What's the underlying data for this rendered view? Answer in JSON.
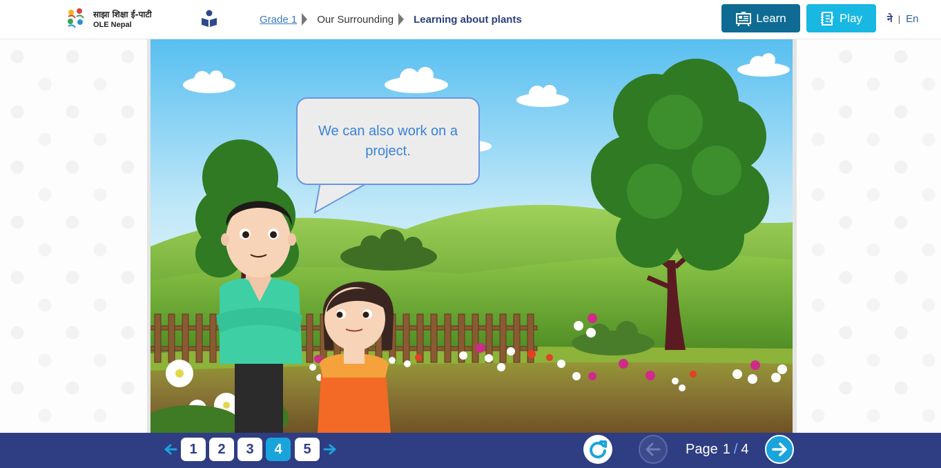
{
  "header": {
    "logo_text_np": "साझा शिक्षा ई-पाटी",
    "logo_text_en": "OLE Nepal",
    "breadcrumb": {
      "grade": "Grade 1",
      "subject": "Our Surrounding",
      "lesson": "Learning about plants"
    },
    "learn_label": "Learn",
    "play_label": "Play",
    "lang_np": "ने",
    "lang_sep": "|",
    "lang_en": "En"
  },
  "scene": {
    "speech_text": "We can also work on a project."
  },
  "footer": {
    "pages": [
      "1",
      "2",
      "3",
      "4",
      "5"
    ],
    "active_page": "4",
    "page_label": "Page",
    "current_page": "1",
    "page_sep": "/",
    "total_pages": "4"
  },
  "colors": {
    "header_learn": "#0f6b93",
    "header_play": "#18b8e2",
    "footer_bg": "#2f3d82",
    "active_page": "#1aa4dc",
    "speech_text": "#3a82d8"
  },
  "icons": {
    "logo": "ole-nepal-logo",
    "book": "book-reader-icon",
    "learn": "learn-board-icon",
    "play": "play-notebook-icon",
    "prev_small": "arrow-left-icon",
    "next_small": "arrow-right-icon",
    "reload": "reload-icon",
    "prev": "arrow-left-circle-icon",
    "next": "arrow-right-circle-icon"
  }
}
